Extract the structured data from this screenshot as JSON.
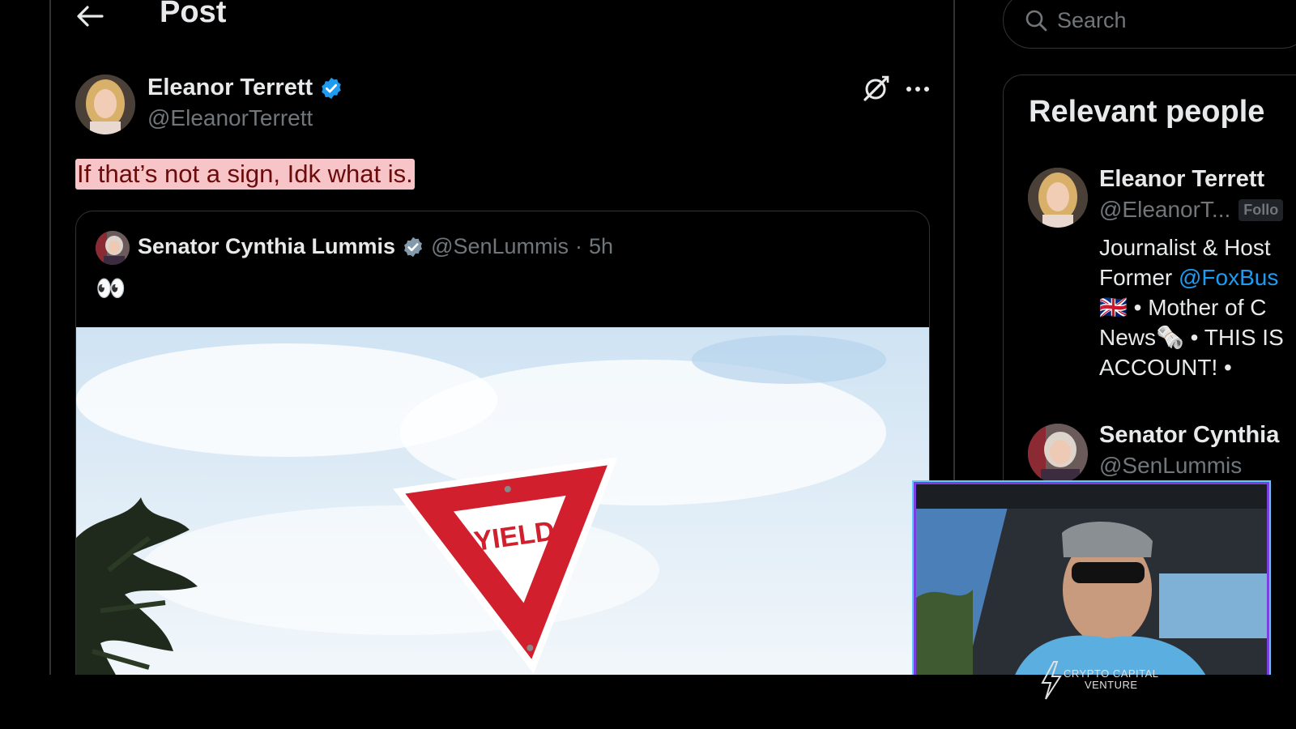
{
  "header": {
    "title": "Post"
  },
  "post": {
    "author_name": "Eleanor Terrett",
    "author_handle": "@EleanorTerrett",
    "text": "If that’s not a sign, Idk what is."
  },
  "quote": {
    "author_name": "Senator Cynthia Lummis",
    "author_handle": "@SenLummis",
    "separator": "·",
    "time": "5h",
    "text": "👀",
    "image_sign_text": "YIELD"
  },
  "search": {
    "placeholder": "Search"
  },
  "relevant_people": {
    "title": "Relevant people",
    "people": [
      {
        "name": "Eleanor Terrett",
        "handle": "@EleanorT...",
        "badge": "Follo",
        "bio": {
          "line1": "Journalist & Host",
          "line2_prefix": "Former ",
          "line2_link": "@FoxBus",
          "line3_flag": "🇬🇧",
          "line3_text": " • Mother of C",
          "line4": "News🗞️ • THIS IS",
          "line5": "ACCOUNT! •"
        }
      },
      {
        "name": "Senator Cynthia",
        "handle": "@SenLummis"
      }
    ]
  },
  "overlay": {
    "brand_line1": "CRYPTO CAPITAL",
    "brand_line2": "VENTURE"
  },
  "colors": {
    "background": "#000000",
    "verified_blue": "#1d9bf0",
    "verified_gray": "#829aab",
    "highlight": "#f7c4c8",
    "muted": "#71767b"
  }
}
